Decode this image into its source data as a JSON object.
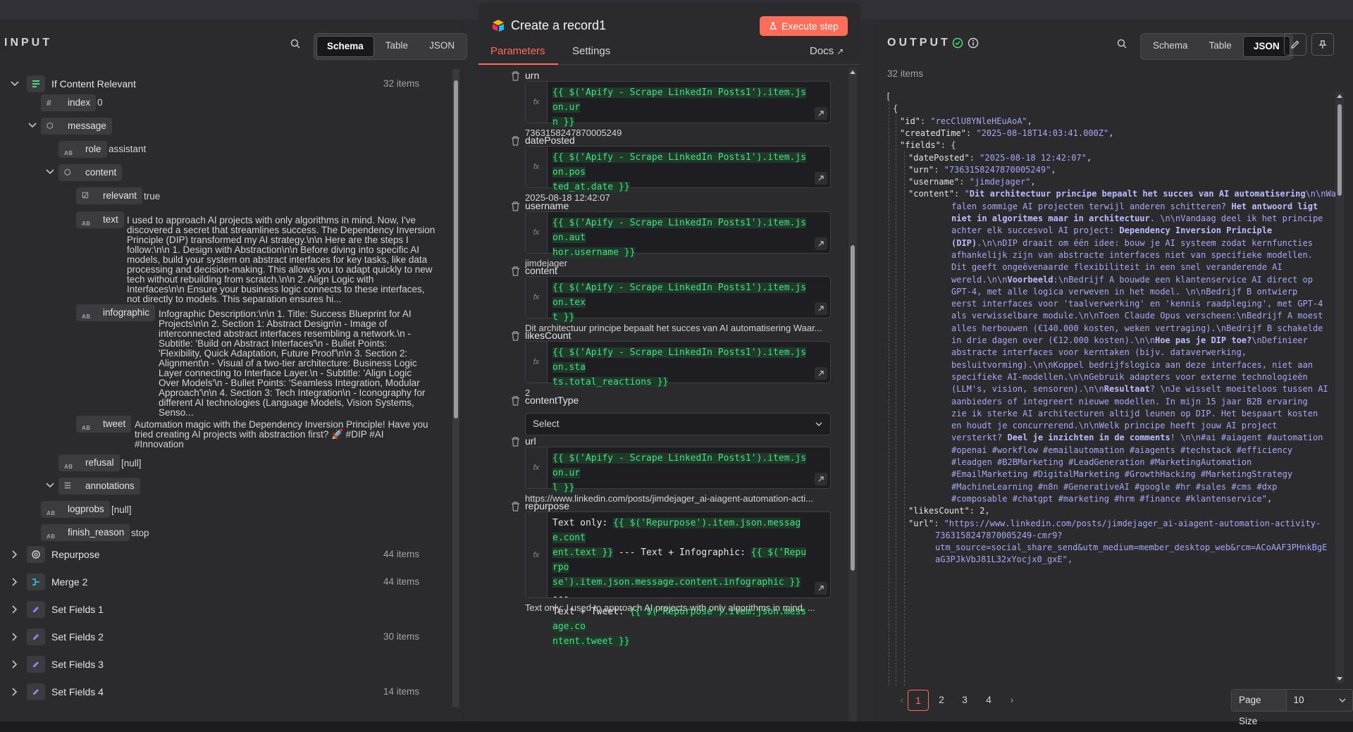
{
  "input": {
    "title": "INPUT",
    "view_tabs": [
      "Schema",
      "Table",
      "JSON"
    ],
    "active_tab": "Schema",
    "nodes": [
      {
        "label": "If Content Relevant",
        "count": "32 items",
        "expanded": true
      },
      {
        "label": "Repurpose",
        "count": "44 items"
      },
      {
        "label": "Merge 2",
        "count": "44 items"
      },
      {
        "label": "Set Fields 1",
        "count": ""
      },
      {
        "label": "Set Fields 2",
        "count": "30 items"
      },
      {
        "label": "Set Fields 3",
        "count": ""
      },
      {
        "label": "Set Fields 4",
        "count": "14 items"
      }
    ],
    "fields": {
      "index": {
        "key": "index",
        "type": "#",
        "value": "0"
      },
      "message": {
        "key": "message"
      },
      "role": {
        "key": "role",
        "type": "AB",
        "value": "assistant"
      },
      "content": {
        "key": "content"
      },
      "relevant": {
        "key": "relevant",
        "value": "true"
      },
      "text": {
        "key": "text",
        "type": "AB",
        "lines": [
          "I used to approach AI projects with only algorithms in mind. Now, I've",
          "discovered a secret that streamlines success. The Dependency Inversion",
          "Principle (DIP) transformed my AI strategy.\\n\\n Here are the steps I",
          "follow:\\n\\n 1. Design with Abstraction\\n\\n Before diving into specific AI",
          "models, build your system on abstract interfaces for key tasks, like data",
          "processing and decision-making. This allows you to adapt quickly to new",
          "tech without rebuilding from scratch.\\n\\n 2. Align Logic with",
          "Interfaces\\n\\n Ensure your business logic connects to these interfaces,",
          "not directly to models. This separation ensures hi..."
        ]
      },
      "infographic": {
        "key": "infographic",
        "type": "AB",
        "lines": [
          "Infographic Description:\\n\\n 1. Title: Success Blueprint for AI",
          "Projects\\n\\n 2. Section 1: Abstract Design\\n - Image of",
          "interconnected abstract interfaces resembling a network.\\n -",
          "Subtitle: 'Build on Abstract Interfaces'\\n - Bullet Points:",
          "'Flexibility, Quick Adaptation, Future Proof'\\n\\n 3. Section 2:",
          "Alignment\\n - Visual of a two-tier architecture: Business Logic",
          "Layer connecting to Interface Layer.\\n - Subtitle: 'Align Logic",
          "Over Models'\\n - Bullet Points: 'Seamless Integration, Modular",
          "Approach'\\n\\n 4. Section 3: Tech Integration\\n - Iconography for",
          "different AI technologies (Language Models, Vision Systems,",
          "Senso..."
        ]
      },
      "tweet": {
        "key": "tweet",
        "type": "AB",
        "lines": [
          "Automation magic with the Dependency Inversion Principle! Have you",
          "tried creating AI projects with abstraction first? 🚀 #DIP #AI",
          "#Innovation"
        ]
      },
      "refusal": {
        "key": "refusal",
        "type": "AB",
        "value": "[null]"
      },
      "annotations": {
        "key": "annotations"
      },
      "logprobs": {
        "key": "logprobs",
        "type": "AB",
        "value": "[null]"
      },
      "finish_reason": {
        "key": "finish_reason",
        "type": "AB",
        "value": "stop"
      }
    }
  },
  "editor": {
    "title": "Create a record1",
    "execute_label": "Execute step",
    "tabs": [
      "Parameters",
      "Settings"
    ],
    "docs_label": "Docs",
    "fields": [
      {
        "label": "urn",
        "expr": "{{ $('Apify - Scrape LinkedIn Posts1').item.json.urn }}",
        "expr_lines": [
          "{{ $('Apify - Scrape LinkedIn Posts1').item.json.ur",
          "n }}"
        ],
        "preview": "7363158247870005249"
      },
      {
        "label": "datePosted",
        "expr_lines": [
          "{{ $('Apify - Scrape LinkedIn Posts1').item.json.pos",
          "ted_at.date }}"
        ],
        "preview": "2025-08-18 12:42:07"
      },
      {
        "label": "username",
        "expr_lines": [
          "{{ $('Apify - Scrape LinkedIn Posts1').item.json.aut",
          "hor.username }}"
        ],
        "preview": "jimdejager"
      },
      {
        "label": "content",
        "expr_lines": [
          "{{ $('Apify - Scrape LinkedIn Posts1').item.json.tex",
          "t }}"
        ],
        "preview": "Dit architectuur principe bepaalt het succes van AI automatisering Waar..."
      },
      {
        "label": "likesCount",
        "expr_lines": [
          "{{ $('Apify - Scrape LinkedIn Posts1').item.json.sta",
          "ts.total_reactions }}"
        ],
        "preview": "2"
      },
      {
        "label": "contentType",
        "select": "Select"
      },
      {
        "label": "url",
        "expr_lines": [
          "{{ $('Apify - Scrape LinkedIn Posts1').item.json.ur",
          "l }}"
        ],
        "preview": "https://www.linkedin.com/posts/jimdejager_ai-aiagent-automation-acti..."
      },
      {
        "label": "repurpose",
        "expr_lines_mixed": [
          [
            {
              "t": "Text only:  ",
              "p": true
            },
            {
              "t": "{{ $('Repurpose').item.json.message.cont"
            }
          ],
          [
            {
              "t": "ent.text }}"
            },
            {
              "t": "  ---  Text + Infographic:  ",
              "p": true
            },
            {
              "t": "{{ $('Repurpo"
            }
          ],
          [
            {
              "t": "se').item.json.message.content.infographic }}"
            },
            {
              "t": "  ---",
              "p": true
            }
          ],
          [
            {
              "t": "Text + Tweet: ",
              "p": true
            },
            {
              "t": "{{ $('Repurpose').item.json.message.co"
            }
          ],
          [
            {
              "t": "ntent.tweet }}"
            }
          ]
        ],
        "preview": "Text only:  I used to approach AI projects with only algorithms in mind. ..."
      }
    ]
  },
  "output": {
    "title": "OUTPUT",
    "count": "32 items",
    "view_tabs": [
      "Schema",
      "Table",
      "JSON"
    ],
    "active_tab": "JSON",
    "pages": [
      "1",
      "2",
      "3",
      "4"
    ],
    "active_page": "1",
    "page_size_label": "Page Size",
    "page_size": "10",
    "json": {
      "id": "recClU8YNleHEuAoA",
      "createdTime": "2025-08-18T14:03:41.000Z",
      "datePosted": "2025-08-18 12:42:07",
      "urn": "7363158247870005249",
      "username": "jimdejager",
      "likesCount": "2",
      "content_lines": [
        [
          {
            "t": "\"",
            "c": "s"
          },
          {
            "t": "Dit architectuur principe bepaalt het succes van AI automatisering",
            "c": "b"
          },
          {
            "t": "\\n\\nWaarom",
            "c": "s"
          }
        ],
        [
          {
            "t": "falen sommige AI projecten terwijl anderen schitteren? ",
            "c": "s"
          },
          {
            "t": "Het antwoord ligt",
            "c": "b"
          }
        ],
        [
          {
            "t": "niet in algoritmes maar in architectuur",
            "c": "b"
          },
          {
            "t": ". \\n\\nVandaag deel ik het principe",
            "c": "s"
          }
        ],
        [
          {
            "t": "achter elk succesvol AI project: ",
            "c": "s"
          },
          {
            "t": "Dependency Inversion Principle",
            "c": "b"
          }
        ],
        [
          {
            "t": "(DIP)",
            "c": "b"
          },
          {
            "t": ".\\n\\nDIP draait om één idee: bouw je AI systeem zodat kernfuncties",
            "c": "s"
          }
        ],
        [
          {
            "t": "afhankelijk zijn van abstracte interfaces niet van specifieke modellen.",
            "c": "s"
          }
        ],
        [
          {
            "t": "Dit geeft ongeëvenaarde flexibiliteit in een snel veranderende AI",
            "c": "s"
          }
        ],
        [
          {
            "t": "wereld.\\n\\n",
            "c": "s"
          },
          {
            "t": "Voorbeeld",
            "c": "b"
          },
          {
            "t": ":\\nBedrijf A bouwde een klantenservice AI direct op",
            "c": "s"
          }
        ],
        [
          {
            "t": "GPT-4, met alle logica verweven in het model. \\n\\nBedrijf B ontwierp",
            "c": "s"
          }
        ],
        [
          {
            "t": "eerst interfaces voor 'taalverwerking' en 'kennis raadpleging', met GPT-4",
            "c": "s"
          }
        ],
        [
          {
            "t": "als verwisselbare module.\\n\\nToen Claude Opus verscheen:\\nBedrijf A moest",
            "c": "s"
          }
        ],
        [
          {
            "t": "alles herbouwen (€140.000 kosten, weken vertraging).\\nBedrijf B schakelde",
            "c": "s"
          }
        ],
        [
          {
            "t": "in drie dagen over (€12.000 kosten).\\n\\n",
            "c": "s"
          },
          {
            "t": "Hoe pas je DIP toe?",
            "c": "b"
          },
          {
            "t": "\\nDefinieer",
            "c": "s"
          }
        ],
        [
          {
            "t": "abstracte interfaces voor kerntaken (bijv. dataverwerking,",
            "c": "s"
          }
        ],
        [
          {
            "t": "besluitvorming).\\n\\nKoppel bedrijfslogica aan deze interfaces, niet aan",
            "c": "s"
          }
        ],
        [
          {
            "t": "specifieke AI-modellen.\\n\\nGebruik adapters voor externe technologieën",
            "c": "s"
          }
        ],
        [
          {
            "t": "(LLM's, vision, sensoren).\\n\\n",
            "c": "s"
          },
          {
            "t": "Resultaat",
            "c": "b"
          },
          {
            "t": "? \\nJe wisselt moeiteloos tussen AI",
            "c": "s"
          }
        ],
        [
          {
            "t": "aanbieders of integreert nieuwe modellen. In mijn 15 jaar B2B ervaring",
            "c": "s"
          }
        ],
        [
          {
            "t": "zie ik sterke AI architecturen altijd leunen op DIP. Het bespaart kosten",
            "c": "s"
          }
        ],
        [
          {
            "t": "en houdt je concurrerend.\\n\\nWelk principe heeft jouw AI project",
            "c": "s"
          }
        ],
        [
          {
            "t": "versterkt? ",
            "c": "s"
          },
          {
            "t": "Deel je inzichten in de comments",
            "c": "b"
          },
          {
            "t": "! \\n\\n#ai #aiagent #automation",
            "c": "s"
          }
        ],
        [
          {
            "t": "#openai #workflow #emailautomation #aiagents #techstack #efficiency",
            "c": "s"
          }
        ],
        [
          {
            "t": "#leadgen #B2BMarketing #LeadGeneration #MarketingAutomation",
            "c": "s"
          }
        ],
        [
          {
            "t": "#EmailMarketing #DigitalMarketing #GrowthHacking #MarketingStrategy",
            "c": "s"
          }
        ],
        [
          {
            "t": "#MachineLearning #n8n #GenerativeAI #google #hr #sales #cms #dxp",
            "c": "s"
          }
        ],
        [
          {
            "t": "#composable #chatgpt #marketing #hrm #finance #klantenservice\"",
            "c": "s"
          },
          {
            "t": ",",
            "c": "p"
          }
        ]
      ],
      "url_lines": [
        "\"https://www.linkedin.com/posts/jimdejager_ai-aiagent-automation-activity-",
        "7363158247870005249-cmr9?",
        "utm_source=social_share_send&utm_medium=member_desktop_web&rcm=ACoAAF3PHnkBgE",
        "aG3PJkVbJ81L32xYocjx0_gxE\","
      ]
    }
  },
  "colors": {
    "accent": "#ff6d5a",
    "json_string": "#a5a8f5",
    "expr_green": "#4ade80"
  }
}
